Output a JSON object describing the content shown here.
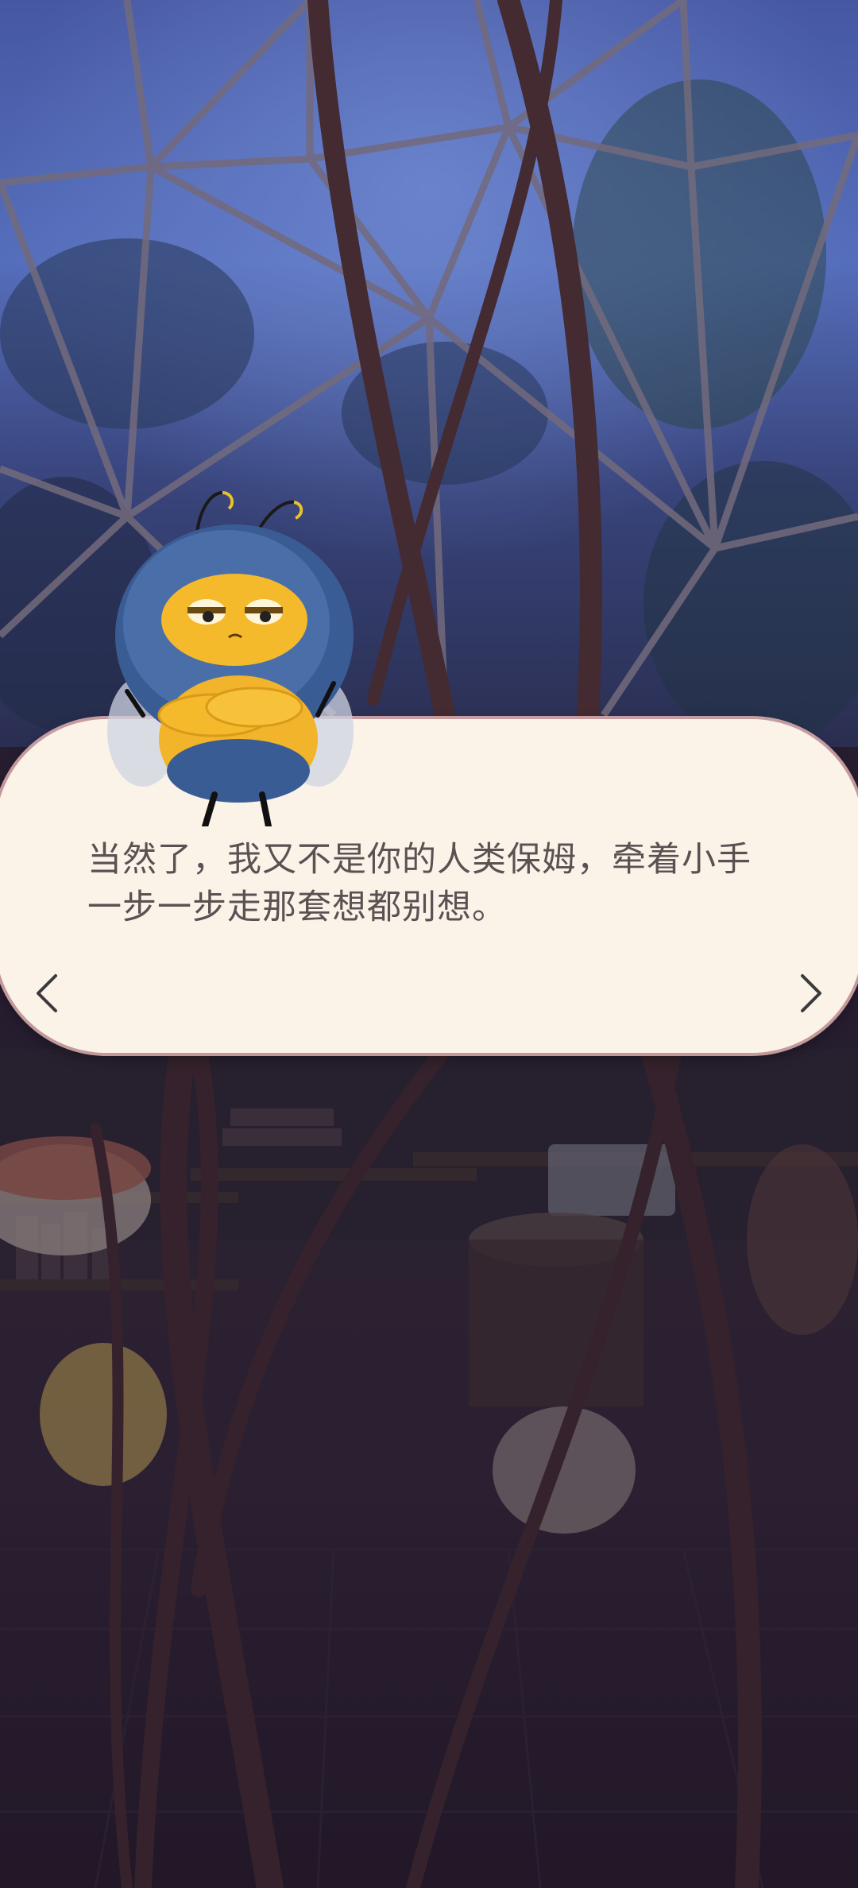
{
  "dialog": {
    "line1": "当然了，我又不是你的人类保姆，牵着小手",
    "line2": "一步一步走那套想都别想。"
  },
  "navigation": {
    "prev_icon": "chevron-left-icon",
    "next_icon": "chevron-right-icon"
  },
  "colors": {
    "dialog_bg": "#fbf2e8",
    "dialog_border": "#e0b0b0",
    "dialog_text": "#595252",
    "sky": "#5a73c4",
    "floor": "#2c2035"
  }
}
